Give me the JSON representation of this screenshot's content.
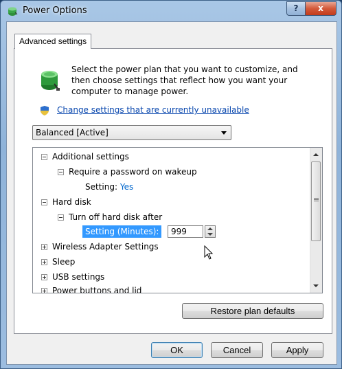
{
  "window": {
    "title": "Power Options",
    "help_label": "?",
    "close_label": "x"
  },
  "tab": {
    "label": "Advanced settings"
  },
  "intro_text": "Select the power plan that you want to customize, and then choose settings that reflect how you want your computer to manage power.",
  "change_link": "Change settings that are currently unavailable",
  "plan_select": {
    "value": "Balanced [Active]"
  },
  "tree": {
    "items": [
      {
        "label": "Additional settings",
        "expander": "minus"
      },
      {
        "label": "Require a password on wakeup",
        "expander": "minus"
      },
      {
        "setting_prefix": "Setting:",
        "setting_value": "Yes"
      },
      {
        "label": "Hard disk",
        "expander": "minus"
      },
      {
        "label": "Turn off hard disk after",
        "expander": "minus"
      },
      {
        "edit_label": "Setting (Minutes):",
        "edit_value": "999"
      },
      {
        "label": "Wireless Adapter Settings",
        "expander": "plus"
      },
      {
        "label": "Sleep",
        "expander": "plus"
      },
      {
        "label": "USB settings",
        "expander": "plus"
      },
      {
        "label": "Power buttons and lid",
        "expander": "plus"
      }
    ]
  },
  "buttons": {
    "restore": "Restore plan defaults",
    "ok": "OK",
    "cancel": "Cancel",
    "apply": "Apply"
  },
  "colors": {
    "link": "#0645ad",
    "setting_value": "#0066cc",
    "selection": "#3399ff",
    "close_button": "#c23b1b"
  },
  "icons": [
    "power-plan-icon",
    "uac-shield-icon",
    "mouse-pointer-icon"
  ]
}
